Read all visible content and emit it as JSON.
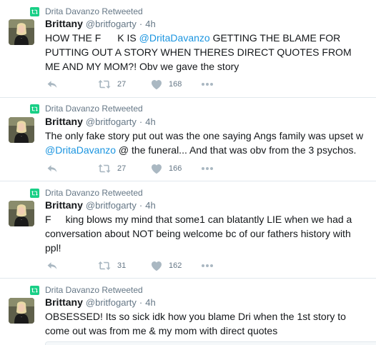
{
  "colors": {
    "accent": "#1b95e0",
    "retweet_green": "#19cf86",
    "muted": "#657786",
    "divider": "#e1e8ed"
  },
  "tweets": [
    {
      "context": "Drita Davanzo Retweeted",
      "name": "Brittany",
      "handle": "@britfogarty",
      "time": "4h",
      "lines": [
        {
          "a": "HOW THE F",
          "b": "K IS ",
          "mention": "@DritaDavanzo",
          "c": " GETTING THE BLAME FOR"
        },
        {
          "a": "PUTTING OUT A STORY WHEN THERES DIRECT QUOTES FROM"
        },
        {
          "a": "ME AND MY MOM?! Obv we gave the story"
        }
      ],
      "retweets": "27",
      "likes": "168"
    },
    {
      "context": "Drita Davanzo Retweeted",
      "name": "Brittany",
      "handle": "@britfogarty",
      "time": "4h",
      "lines": [
        {
          "a": "The only fake story put out was the one saying Angs family was upset w"
        },
        {
          "mention": "@DritaDavanzo",
          "c": " @ the funeral... And that was obv from the 3 psychos."
        }
      ],
      "retweets": "27",
      "likes": "166"
    },
    {
      "context": "Drita Davanzo Retweeted",
      "name": "Brittany",
      "handle": "@britfogarty",
      "time": "4h",
      "lines": [
        {
          "a": "F",
          "b": "king blows my mind that some1 can blatantly LIE when we had a"
        },
        {
          "a": "conversation about NOT being welcome bc of our fathers history with"
        },
        {
          "a": "ppl!"
        }
      ],
      "retweets": "31",
      "likes": "162"
    },
    {
      "context": "Drita Davanzo Retweeted",
      "name": "Brittany",
      "handle": "@britfogarty",
      "time": "4h",
      "lines": [
        {
          "a": "OBSESSED! Its so sick idk how you blame Dri when the 1st story to"
        },
        {
          "a": "come out was from me & my mom with direct quotes"
        }
      ]
    }
  ],
  "icons": {
    "reply": "reply-icon",
    "retweet": "retweet-icon",
    "like": "heart-icon",
    "more": "more-icon",
    "context": "retweet-badge-icon",
    "avatar": "avatar-image"
  }
}
